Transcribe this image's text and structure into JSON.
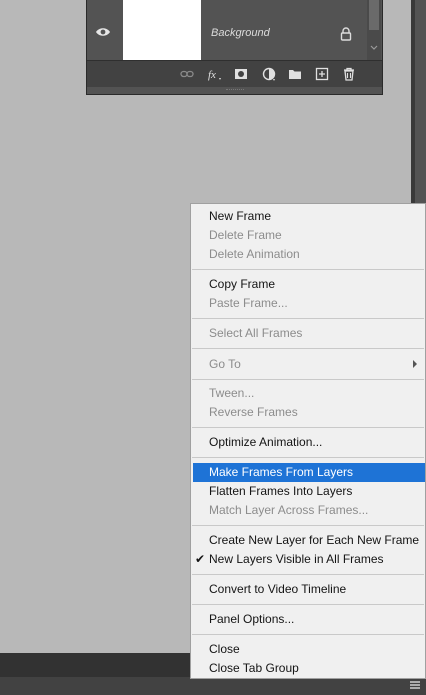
{
  "layers": {
    "layer_name": "Background"
  },
  "menu": {
    "items": [
      {
        "label": "New Frame"
      },
      {
        "label": "Delete Frame"
      },
      {
        "label": "Delete Animation"
      },
      {
        "label": "Copy Frame"
      },
      {
        "label": "Paste Frame..."
      },
      {
        "label": "Select All Frames"
      },
      {
        "label": "Go To"
      },
      {
        "label": "Tween..."
      },
      {
        "label": "Reverse Frames"
      },
      {
        "label": "Optimize Animation..."
      },
      {
        "label": "Make Frames From Layers"
      },
      {
        "label": "Flatten Frames Into Layers"
      },
      {
        "label": "Match Layer Across Frames..."
      },
      {
        "label": "Create New Layer for Each New Frame"
      },
      {
        "label": "New Layers Visible in All Frames"
      },
      {
        "label": "Convert to Video Timeline"
      },
      {
        "label": "Panel Options..."
      },
      {
        "label": "Close"
      },
      {
        "label": "Close Tab Group"
      }
    ],
    "checkmark": "✔"
  },
  "colors": {
    "highlight": "#1e73d6",
    "menu_bg": "#f0f0f0",
    "panel_bg": "#535353"
  }
}
